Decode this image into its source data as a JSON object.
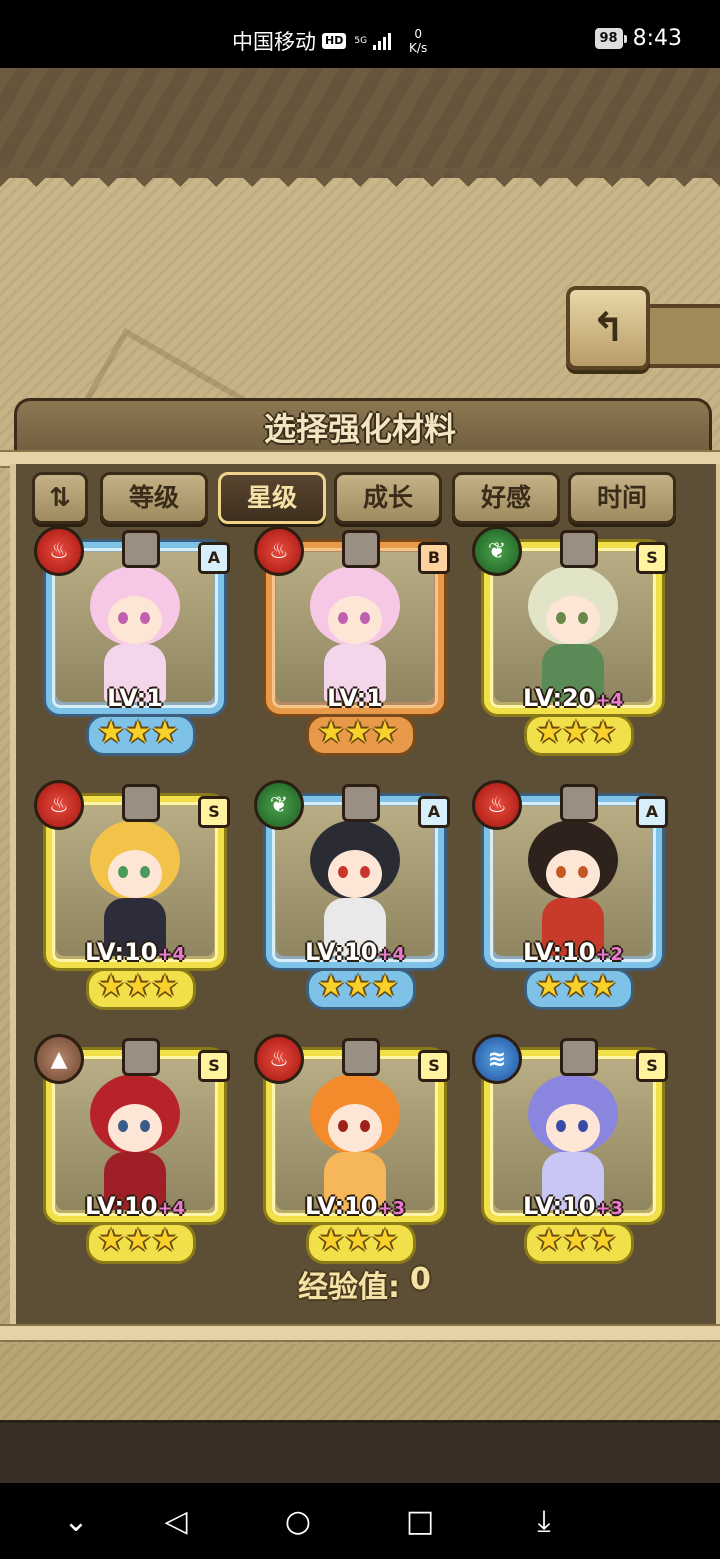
{
  "status_bar": {
    "carrier": "中国移动",
    "hd": "HD",
    "network": "5G",
    "speed_value": "0",
    "speed_unit": "K/s",
    "battery": "98",
    "time": "8:43"
  },
  "panel": {
    "title": "选择强化材料"
  },
  "tabs": [
    {
      "label": "等级"
    },
    {
      "label": "星级"
    },
    {
      "label": "成长"
    },
    {
      "label": "好感"
    },
    {
      "label": "时间"
    }
  ],
  "active_tab": "星级",
  "cards": [
    {
      "element": "fire",
      "rank": "A",
      "level": "LV:1",
      "plus": "",
      "stars": "★★★",
      "rarity": "A",
      "hair": "#f6c8e6",
      "eyes": "#c060b0",
      "outfit": "#f4d6ec"
    },
    {
      "element": "fire",
      "rank": "B",
      "level": "LV:1",
      "plus": "",
      "stars": "★★★",
      "rarity": "B",
      "hair": "#f6c8e6",
      "eyes": "#c060b0",
      "outfit": "#f4d6ec"
    },
    {
      "element": "leaf",
      "rank": "S",
      "level": "LV:20",
      "plus": "+4",
      "stars": "★★★",
      "rarity": "S",
      "hair": "#e2e4c8",
      "eyes": "#6a8a4a",
      "outfit": "#5a8a55"
    },
    {
      "element": "fire",
      "rank": "S",
      "level": "LV:10",
      "plus": "+4",
      "stars": "★★★",
      "rarity": "S",
      "hair": "#f3c349",
      "eyes": "#4a9a5a",
      "outfit": "#2c2c3a"
    },
    {
      "element": "leaf",
      "rank": "A",
      "level": "LV:10",
      "plus": "+4",
      "stars": "★★★",
      "rarity": "A",
      "hair": "#2b2b34",
      "eyes": "#c8352c",
      "outfit": "#e9e9e9"
    },
    {
      "element": "fire",
      "rank": "A",
      "level": "LV:10",
      "plus": "+2",
      "stars": "★★★",
      "rarity": "A",
      "hair": "#2e221c",
      "eyes": "#c25a22",
      "outfit": "#c83b2a"
    },
    {
      "element": "earth",
      "rank": "S",
      "level": "LV:10",
      "plus": "+4",
      "stars": "★★★",
      "rarity": "S",
      "hair": "#b8232a",
      "eyes": "#3a5a8a",
      "outfit": "#9e1f25"
    },
    {
      "element": "fire",
      "rank": "S",
      "level": "LV:10",
      "plus": "+3",
      "stars": "★★★",
      "rarity": "S",
      "hair": "#f38a2c",
      "eyes": "#a0201a",
      "outfit": "#f6b65a"
    },
    {
      "element": "water",
      "rank": "S",
      "level": "LV:10",
      "plus": "+3",
      "stars": "★★★",
      "rarity": "S",
      "hair": "#8a86e0",
      "eyes": "#3a4aa8",
      "outfit": "#c9c6f6"
    }
  ],
  "exp": {
    "label": "经验值:",
    "value": "0"
  },
  "icons": {
    "back": "back-arrow-icon",
    "sort": "sort-icon",
    "fire": "fire-element-icon",
    "leaf": "leaf-element-icon",
    "earth": "earth-element-icon",
    "water": "water-element-icon"
  }
}
